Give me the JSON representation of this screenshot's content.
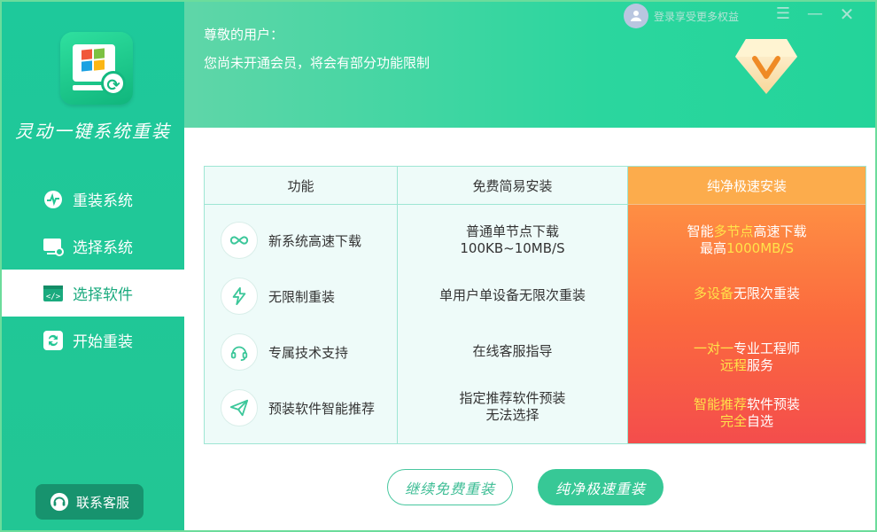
{
  "app": {
    "title": "灵动一键系统重装"
  },
  "sidebar": {
    "items": [
      {
        "label": "重装系统",
        "icon": "pulse-chat-icon",
        "active": false
      },
      {
        "label": "选择系统",
        "icon": "monitor-gear-icon",
        "active": false
      },
      {
        "label": "选择软件",
        "icon": "code-window-icon",
        "active": true
      },
      {
        "label": "开始重装",
        "icon": "refresh-icon",
        "active": false
      }
    ],
    "service_label": "联系客服"
  },
  "header": {
    "greeting_line1": "尊敬的用户：",
    "greeting_line2": "您尚未开通会员，将会有部分功能限制",
    "login_text": "登录享受更多权益"
  },
  "table": {
    "headers": {
      "func": "功能",
      "free": "免费简易安装",
      "pure": "纯净极速安装"
    },
    "rows": [
      {
        "icon": "infinity-icon",
        "func": "新系统高速下载",
        "free": [
          "普通单节点下载",
          "100KB~10MB/S"
        ],
        "pure_line1": [
          {
            "t": "智能",
            "hl": false
          },
          {
            "t": "多节点",
            "hl": true
          },
          {
            "t": "高速下载",
            "hl": false
          }
        ],
        "pure_line2": [
          {
            "t": "最高",
            "hl": false
          },
          {
            "t": "1000MB/S",
            "hl": true
          }
        ]
      },
      {
        "icon": "lightning-icon",
        "func": "无限制重装",
        "free": [
          "单用户单设备无限次重装"
        ],
        "pure_line1": [
          {
            "t": "多设备",
            "hl": true
          },
          {
            "t": "无限次重装",
            "hl": false
          }
        ],
        "pure_line2": []
      },
      {
        "icon": "headset-icon",
        "func": "专属技术支持",
        "free": [
          "在线客服指导"
        ],
        "pure_line1": [
          {
            "t": "一对一",
            "hl": true
          },
          {
            "t": "专业工程师",
            "hl": false
          }
        ],
        "pure_line2": [
          {
            "t": "远程",
            "hl": true
          },
          {
            "t": "服务",
            "hl": false
          }
        ]
      },
      {
        "icon": "paper-plane-icon",
        "func": "预装软件智能推荐",
        "free": [
          "指定推荐软件预装",
          "无法选择"
        ],
        "pure_line1": [
          {
            "t": "智能推荐",
            "hl": true
          },
          {
            "t": "软件预装",
            "hl": false
          }
        ],
        "pure_line2": [
          {
            "t": "完全",
            "hl": true
          },
          {
            "t": "自选",
            "hl": false
          }
        ]
      }
    ]
  },
  "buttons": {
    "free": "继续免费重装",
    "pure": "纯净极速重装"
  },
  "colors": {
    "brand": "#22c694",
    "highlight": "#ffe24a",
    "pure_top": "#fcac4c",
    "pure_bottom": "#f44d4c"
  }
}
